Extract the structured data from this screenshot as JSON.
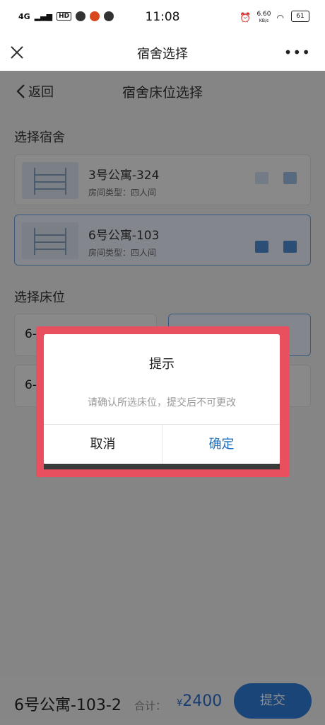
{
  "status_bar": {
    "network": "4G",
    "hd_badge": "HD",
    "time": "11:08",
    "speed": "6.60",
    "speed_unit": "KB/s",
    "battery": "61"
  },
  "title_bar": {
    "title": "宿舍选择",
    "close_icon": "close-icon",
    "more_icon": "more-icon"
  },
  "page": {
    "back_label": "返回",
    "title": "宿舍床位选择",
    "dorm_section": "选择宿舍",
    "bed_section": "选择床位",
    "dorms": [
      {
        "name": "3号公寓-324",
        "type": "房间类型：四人间"
      },
      {
        "name": "6号公寓-103",
        "type": "房间类型：四人间"
      }
    ],
    "beds": [
      {
        "label": "6-"
      },
      {
        "label": "6-"
      }
    ]
  },
  "dialog": {
    "title": "提示",
    "message": "请确认所选床位，提交后不可更改",
    "cancel": "取消",
    "confirm": "确定"
  },
  "bottom_bar": {
    "room": "6号公寓-103-2",
    "total_label": "合计：",
    "currency": "¥",
    "price": "2400",
    "submit": "提交"
  },
  "colors": {
    "accent": "#2f7fdc",
    "highlight": "#e8505f",
    "confirm_text": "#1f6fbd"
  }
}
